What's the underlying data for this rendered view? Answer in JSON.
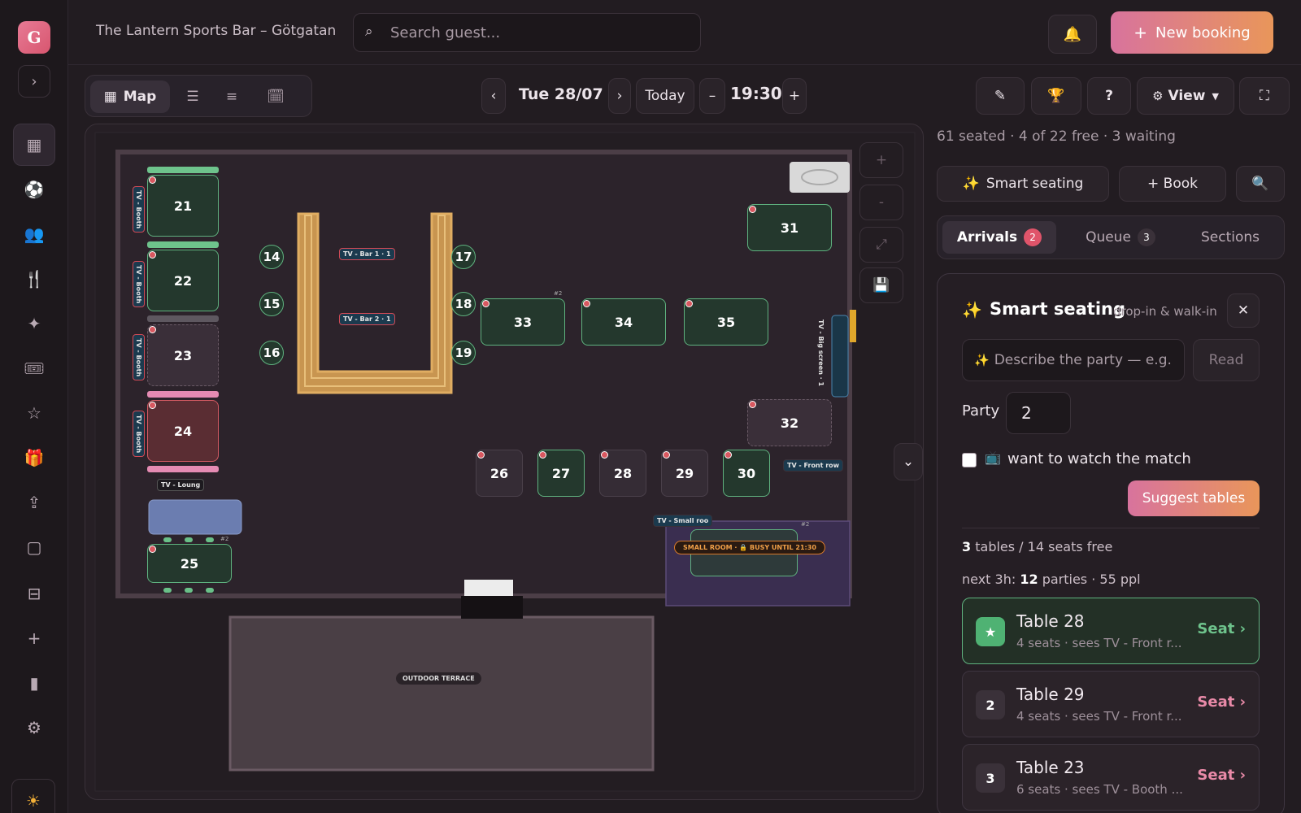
{
  "app": {
    "avatar_letter": "G",
    "venue": "The Lantern Sports Bar – Götgatan"
  },
  "search": {
    "placeholder": "Search guest..."
  },
  "header": {
    "new_booking_label": "New booking"
  },
  "views": {
    "map_label": "Map"
  },
  "datebar": {
    "date": "Tue 28/07",
    "today_label": "Today",
    "time": "19:30",
    "minus": "–",
    "plus": "+"
  },
  "toolbar": {
    "view_label": "View",
    "help": "?"
  },
  "stats": {
    "text": "61 seated · 4 of 22 free · 3 waiting"
  },
  "actions": {
    "smart_seating_label": "Smart seating",
    "book_label": "+ Book"
  },
  "tabs": [
    {
      "label": "Arrivals",
      "count": "2"
    },
    {
      "label": "Queue",
      "count": "3"
    },
    {
      "label": "Sections"
    }
  ],
  "smart": {
    "title": "Smart seating",
    "subtitle": "drop-in & walk-in",
    "describe_placeholder": "Describe the party — e.g.",
    "read_label": "Read",
    "party_label": "Party",
    "party_value": "2",
    "match_label": "want to watch the match",
    "suggest_label": "Suggest tables",
    "summary_count": "3",
    "summary_text": "tables / 14 seats free",
    "next_prefix": "next 3h:",
    "next_count": "12",
    "next_suffix": "parties · 55 ppl"
  },
  "suggestions": [
    {
      "rank": "★",
      "title": "Table 28",
      "sub": "4 seats · sees TV - Front r...",
      "action": "Seat ›"
    },
    {
      "rank": "2",
      "title": "Table 29",
      "sub": "4 seats · sees TV - Front r...",
      "action": "Seat ›"
    },
    {
      "rank": "3",
      "title": "Table 23",
      "sub": "6 seats · sees TV - Booth ...",
      "action": "Seat ›"
    }
  ],
  "floor": {
    "tables": {
      "t14": "14",
      "t15": "15",
      "t16": "16",
      "t17": "17",
      "t18": "18",
      "t19": "19",
      "t21": "21",
      "t22": "22",
      "t23": "23",
      "t24": "24",
      "t25": "25",
      "t26": "26",
      "t27": "27",
      "t28": "28",
      "t29": "29",
      "t30": "30",
      "t31": "31",
      "t32": "32",
      "t33": "33",
      "t34": "34",
      "t35": "35"
    },
    "tv_labels": {
      "bar1": "TV - Bar 1 · 1",
      "bar2": "TV - Bar 2 · 1",
      "booth": "TV - Booth",
      "lounge": "TV - Loung",
      "front_row": "TV - Front row",
      "small_room": "TV - Small roo",
      "big_screen": "TV - Big screen · 1"
    },
    "small_room_banner": "SMALL ROOM · 🔒 BUSY UNTIL 21:30",
    "terrace_label": "OUTDOOR TERRACE",
    "mark_2": "#2"
  }
}
